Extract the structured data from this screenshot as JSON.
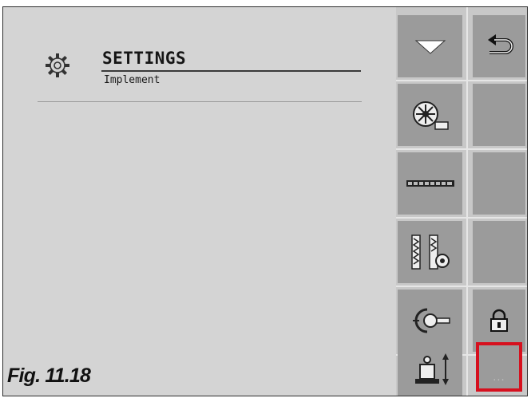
{
  "header": {
    "title": "SETTINGS",
    "subtitle": "Implement"
  },
  "figure": {
    "caption": "Fig. 11.18"
  },
  "sidebar": {
    "buttons": [
      {
        "id": "dropdown",
        "icon": "triangle-down-icon"
      },
      {
        "id": "back",
        "icon": "return-arrow-icon"
      },
      {
        "id": "fan",
        "icon": "fan-speed-icon"
      },
      {
        "id": "sections",
        "icon": "boom-sections-icon"
      },
      {
        "id": "tramline",
        "icon": "tramline-settings-icon"
      },
      {
        "id": "hitch",
        "icon": "hitch-icon"
      },
      {
        "id": "lock",
        "icon": "lock-icon"
      },
      {
        "id": "lift",
        "icon": "implement-lift-icon"
      },
      {
        "id": "more",
        "icon": "more-icon",
        "label": "...",
        "highlighted": true
      }
    ]
  },
  "colors": {
    "highlight": "#d6101e",
    "button": "#9b9b9b",
    "panel": "#d4d4d4"
  }
}
